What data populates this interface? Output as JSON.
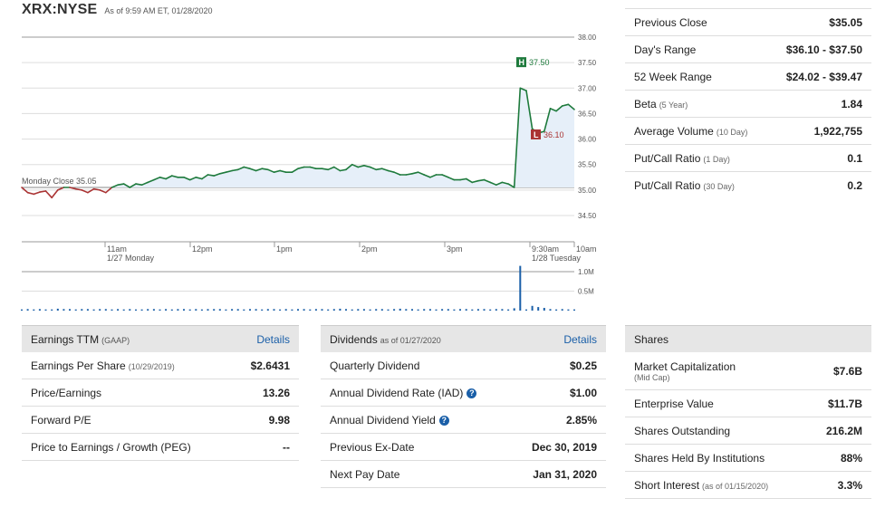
{
  "header": {
    "ticker": "XRX:NYSE",
    "as_of": "As of 9:59 AM ET, 01/28/2020"
  },
  "chart": {
    "high_label": "37.50",
    "low_label": "36.10",
    "high_badge": "H",
    "low_badge": "L",
    "prev_close_label": "Monday Close 35.05",
    "y_ticks": [
      "38.00",
      "37.50",
      "37.00",
      "36.50",
      "36.00",
      "35.50",
      "35.00",
      "34.50"
    ],
    "x_ticks": [
      {
        "line1": "11am",
        "line2": "1/27 Monday"
      },
      {
        "line1": "12pm",
        "line2": ""
      },
      {
        "line1": "1pm",
        "line2": ""
      },
      {
        "line1": "2pm",
        "line2": ""
      },
      {
        "line1": "3pm",
        "line2": ""
      },
      {
        "line1": "9:30am",
        "line2": "1/28 Tuesday"
      },
      {
        "line1": "10am",
        "line2": ""
      }
    ],
    "vol_ticks": [
      "1.0M",
      "0.5M"
    ],
    "colors": {
      "up": "#1e7a3c",
      "down": "#a33",
      "fill": "#e6eff9",
      "vol": "#1a5fa8"
    }
  },
  "chart_data": {
    "type": "line",
    "xlabel": "",
    "ylabel": "",
    "ylim": [
      34.5,
      38.0
    ],
    "prev_close": 35.05,
    "day_high": 37.5,
    "day_low": 36.1,
    "prices": [
      35.05,
      34.95,
      34.92,
      34.96,
      34.98,
      34.85,
      35.0,
      35.05,
      35.05,
      35.02,
      35.0,
      34.95,
      35.02,
      35.0,
      34.95,
      35.05,
      35.1,
      35.12,
      35.05,
      35.12,
      35.1,
      35.15,
      35.2,
      35.25,
      35.22,
      35.28,
      35.25,
      35.25,
      35.2,
      35.25,
      35.22,
      35.3,
      35.28,
      35.32,
      35.35,
      35.38,
      35.4,
      35.45,
      35.42,
      35.38,
      35.42,
      35.4,
      35.35,
      35.38,
      35.35,
      35.35,
      35.42,
      35.45,
      35.45,
      35.42,
      35.42,
      35.4,
      35.45,
      35.38,
      35.4,
      35.5,
      35.45,
      35.48,
      35.45,
      35.4,
      35.42,
      35.38,
      35.35,
      35.3,
      35.3,
      35.32,
      35.35,
      35.3,
      35.25,
      35.3,
      35.3,
      35.25,
      35.2,
      35.2,
      35.22,
      35.15,
      35.18,
      35.2,
      35.15,
      35.1,
      35.15,
      35.12,
      35.05,
      37.0,
      36.95,
      36.2,
      36.12,
      36.15,
      36.6,
      36.55,
      36.65,
      36.68,
      36.58
    ],
    "volume_millions": [
      0.03,
      0.04,
      0.03,
      0.04,
      0.03,
      0.03,
      0.05,
      0.04,
      0.04,
      0.03,
      0.04,
      0.04,
      0.03,
      0.04,
      0.04,
      0.03,
      0.04,
      0.03,
      0.04,
      0.03,
      0.03,
      0.04,
      0.04,
      0.03,
      0.04,
      0.03,
      0.04,
      0.04,
      0.03,
      0.04,
      0.03,
      0.04,
      0.04,
      0.04,
      0.03,
      0.04,
      0.04,
      0.03,
      0.04,
      0.04,
      0.03,
      0.04,
      0.04,
      0.03,
      0.04,
      0.03,
      0.04,
      0.04,
      0.03,
      0.04,
      0.04,
      0.03,
      0.04,
      0.05,
      0.04,
      0.03,
      0.04,
      0.04,
      0.03,
      0.04,
      0.04,
      0.03,
      0.04,
      0.05,
      0.04,
      0.04,
      0.03,
      0.04,
      0.04,
      0.03,
      0.04,
      0.04,
      0.03,
      0.04,
      0.04,
      0.03,
      0.04,
      0.04,
      0.03,
      0.04,
      0.04,
      0.03,
      0.06,
      1.15,
      0.03,
      0.12,
      0.09,
      0.07,
      0.04,
      0.03,
      0.04,
      0.03,
      0.03
    ]
  },
  "stats": {
    "rows": [
      {
        "label": "Previous Close",
        "sub": "",
        "value": "$35.05"
      },
      {
        "label": "Day's Range",
        "sub": "",
        "value": "$36.10 - $37.50"
      },
      {
        "label": "52 Week Range",
        "sub": "",
        "value": "$24.02 - $39.47"
      },
      {
        "label": "Beta",
        "sub": "(5 Year)",
        "value": "1.84"
      },
      {
        "label": "Average Volume",
        "sub": "(10 Day)",
        "value": "1,922,755"
      },
      {
        "label": "Put/Call Ratio",
        "sub": "(1 Day)",
        "value": "0.1"
      },
      {
        "label": "Put/Call Ratio",
        "sub": "(30 Day)",
        "value": "0.2"
      }
    ]
  },
  "earnings": {
    "title": "Earnings TTM",
    "title_sub": "(GAAP)",
    "details": "Details",
    "rows": [
      {
        "label": "Earnings Per Share",
        "sub": "(10/29/2019)",
        "value": "$2.6431"
      },
      {
        "label": "Price/Earnings",
        "sub": "",
        "value": "13.26"
      },
      {
        "label": "Forward P/E",
        "sub": "",
        "value": "9.98"
      },
      {
        "label": "Price to Earnings / Growth (PEG)",
        "sub": "",
        "value": "--"
      }
    ]
  },
  "dividends": {
    "title": "Dividends",
    "title_sub": "as of 01/27/2020",
    "details": "Details",
    "rows": [
      {
        "label": "Quarterly Dividend",
        "value": "$0.25"
      },
      {
        "label": "Annual Dividend Rate (IAD)",
        "value": "$1.00"
      },
      {
        "label": "Annual Dividend Yield",
        "value": "2.85%"
      },
      {
        "label": "Previous Ex-Date",
        "value": "Dec 30, 2019"
      },
      {
        "label": "Next Pay Date",
        "value": "Jan 31, 2020"
      }
    ],
    "help_icon": "?"
  },
  "shares": {
    "title": "Shares",
    "rows": [
      {
        "label": "Market Capitalization",
        "sub": "(Mid Cap)",
        "value": "$7.6B"
      },
      {
        "label": "Enterprise Value",
        "sub": "",
        "value": "$11.7B"
      },
      {
        "label": "Shares Outstanding",
        "sub": "",
        "value": "216.2M"
      },
      {
        "label": "Shares Held By Institutions",
        "sub": "",
        "value": "88%"
      },
      {
        "label": "Short Interest",
        "sub": "(as of 01/15/2020)",
        "value": "3.3%"
      }
    ]
  }
}
